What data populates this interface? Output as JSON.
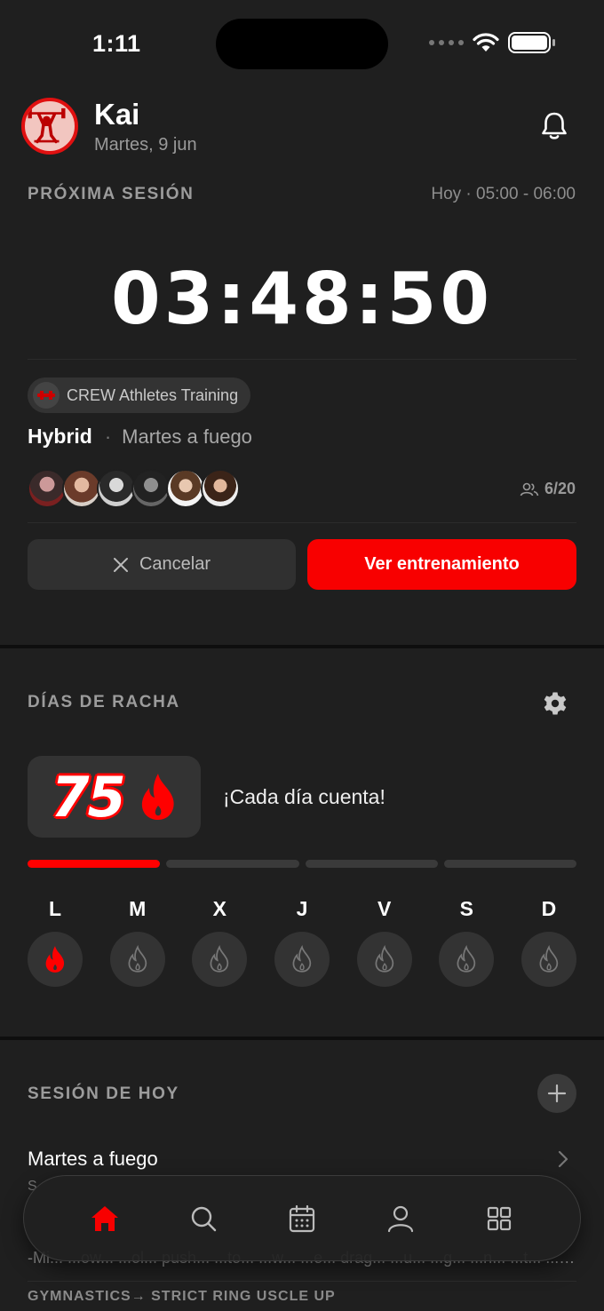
{
  "status_bar": {
    "time": "1:11"
  },
  "header": {
    "name": "Kai",
    "date": "Martes, 9 jun"
  },
  "next_session": {
    "label": "PRÓXIMA SESIÓN",
    "time": "Hoy · 05:00 - 06:00",
    "countdown": "03:48:50",
    "gym": "CREW Athletes Training",
    "class_type": "Hybrid",
    "separator": "·",
    "class_name": "Martes a fuego",
    "capacity": "6/20",
    "cancel_label": "Cancelar",
    "view_label": "Ver entrenamiento",
    "accent_color": "#f80000"
  },
  "streak": {
    "label": "DÍAS DE RACHA",
    "count": "75",
    "message": "¡Cada día cuenta!",
    "progress_segments_filled": 1,
    "progress_segments_total": 4,
    "days": [
      {
        "letter": "L",
        "done": true
      },
      {
        "letter": "M",
        "done": false
      },
      {
        "letter": "X",
        "done": false
      },
      {
        "letter": "J",
        "done": false
      },
      {
        "letter": "V",
        "done": false
      },
      {
        "letter": "S",
        "done": false
      },
      {
        "letter": "D",
        "done": false
      }
    ]
  },
  "today": {
    "label": "SESIÓN DE HOY",
    "session_title": "Martes a fuego",
    "peek_line_1": "S",
    "peek_line_2": "-Mi... ...ow... ...ol... push... ...to... ...w... ...e... drag... ...u... ...g... ...n... ...t... ...w... ...",
    "peek_line_3": "GYMNASTICS→ STRICT RING USCLE UP"
  },
  "tabbar": {
    "items": [
      "home-icon",
      "search-icon",
      "calendar-icon",
      "profile-icon",
      "grid-icon"
    ],
    "active": "home-icon"
  }
}
